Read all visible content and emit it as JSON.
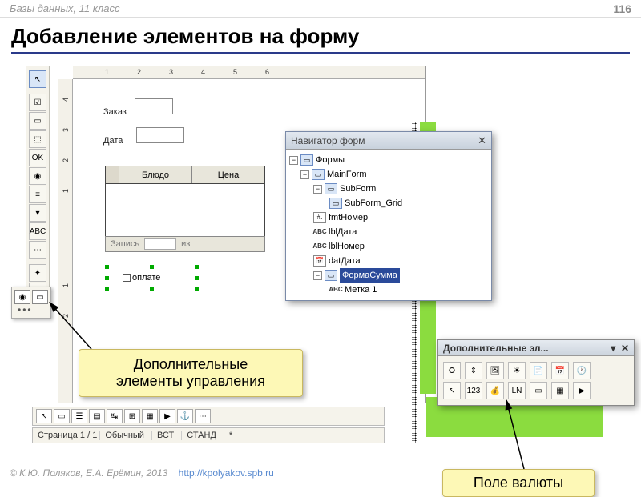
{
  "header": {
    "course": "Базы данных, 11 класс",
    "page": "116"
  },
  "title": "Добавление элементов на форму",
  "form": {
    "field1_label": "Заказ",
    "field2_label": "Дата",
    "grid_cols": [
      "Блюдо",
      "Цена"
    ],
    "record_label": "Запись",
    "of_label": "из",
    "oplate": "оплате"
  },
  "ruler_h": [
    "1",
    "2",
    "3",
    "4",
    "5",
    "6"
  ],
  "ruler_v": [
    "4",
    "3",
    "2",
    "1",
    "1",
    "2"
  ],
  "navigator": {
    "title": "Навигатор форм",
    "root": "Формы",
    "items": [
      {
        "label": "MainForm",
        "icon": "form"
      },
      {
        "label": "SubForm",
        "icon": "form"
      },
      {
        "label": "SubForm_Grid",
        "icon": "form"
      },
      {
        "label": "fmtНомер",
        "icon": "field"
      },
      {
        "label": "lblДата",
        "icon": "abc"
      },
      {
        "label": "lblНомер",
        "icon": "abc"
      },
      {
        "label": "datДата",
        "icon": "date"
      },
      {
        "label": "ФормаСумма",
        "icon": "form",
        "selected": true
      },
      {
        "label": "Метка 1",
        "icon": "abc"
      }
    ]
  },
  "callouts": {
    "c1_line1": "Дополнительные",
    "c1_line2": "элементы управления",
    "c2": "Поле валюты"
  },
  "extra_toolbar": {
    "title": "Дополнительные эл...",
    "num_btn": "123"
  },
  "status": {
    "page": "Страница  1 / 1",
    "mode": "Обычный",
    "ins": "ВСТ",
    "std": "СТАНД",
    "mark": "*"
  },
  "side_labels": {
    "abc": "ABC",
    "ok": "OK"
  },
  "footer": {
    "copy": "© К.Ю. Поляков, Е.А. Ерёмин, 2013",
    "url": "http://kpolyakov.spb.ru"
  }
}
